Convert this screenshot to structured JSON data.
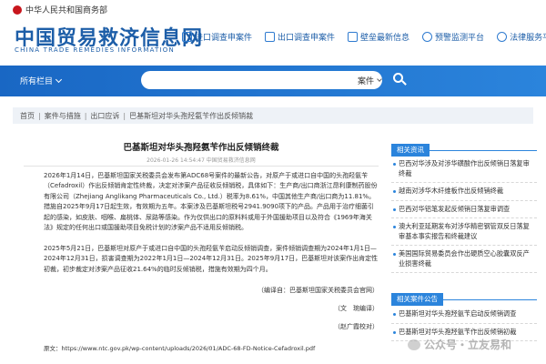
{
  "header": {
    "ministry": "中华人民共和国商务部",
    "site_title": "中国贸易救济信息网",
    "site_title_en": "CHINA TRADE REMEDIES INFORMATION",
    "nav": [
      {
        "label": "进口调查申案件",
        "icon": "document-icon"
      },
      {
        "label": "出口调查申案件",
        "icon": "export-icon"
      },
      {
        "label": "壁垒最新信息",
        "icon": "barrier-icon"
      },
      {
        "label": "预警监测平台",
        "icon": "alert-icon"
      },
      {
        "label": "法律服务平台",
        "icon": "shield-icon"
      }
    ]
  },
  "search": {
    "all_columns": "所有栏目",
    "type_label": "案件",
    "placeholder": ""
  },
  "breadcrumb": [
    "首页",
    "案件与措施",
    "出口应诉",
    "巴基斯坦对华头孢羟氨苄作出反倾销裁"
  ],
  "article": {
    "title": "巴基斯坦对华头孢羟氨苄作出反倾销终裁",
    "date": "2026-01-26 14:54:47  中国贸易救济信息网",
    "para1": "2026年1月14日，巴基斯坦国家关税委员会发布第ADC68号案件的最新公告，对原产于或进口自中国的头孢羟氨苄（Cefadroxil）作出反倾销肯定性终裁，决定对涉案产品征收反倾销税，具体如下：生产商/出口商浙江昂利康制药股份有限公司（Zhejiang Anglikang Pharmaceuticals Co., Ltd.）税率为8.61%，中国其他生产商/出口商为11.81%。措施自2025年9月17日起生效，有效期为五年。本案涉及巴基斯坦税号2941.9090项下的产品。产品用于治疗细菌引起的感染，如皮肤、咽喉、扁桃体、尿路等感染。作为仅供出口的原料料或用于外国援助项目以及符合《1969年海关法》规定的任何出口或国援助项目免税计划的涉案产品不适用反倾销税。",
    "para2": "2025年5月21日，巴基斯坦对原产于或进口自中国的头孢羟氨苄启动反倾销调查，案件倾销调查期为2024年1月1日—2024年12月31日，损害调查期为2022年1月1日—2024年12月31日。2025年9月17日，巴基斯坦对该案作出肯定性初裁，初步裁定对涉案产品征收21.64%的临时反倾销税，措施有效期为四个月。",
    "sig1": "（编译自：巴基斯坦国家关税委员会官网）",
    "sig2": "（文　琬编译）",
    "sig3": "（赵广霞校对）",
    "source": "原文：https://www.ntc.gov.pk/wp-content/uploads/2026/01/ADC-68-FD-Notice-Cefadroxil.pdf"
  },
  "sidebar": {
    "related_news_title": "相关资讯",
    "related_news": [
      "巴西对华涉及对涉华磺酸作出反倾销日落复审终裁",
      "越南对涉华木纤维板作出反倾销终裁",
      "巴西对华铝笔发起反倾销日落复审调查",
      "澳大利亚延期发布对涉华精密钢管双反日落复审基本事实报告和终裁建议",
      "美国国际贸易委员会作出硬质空心胶囊双反产业损害终裁"
    ],
    "related_notice_title": "相关案件公告",
    "related_notices": [
      "巴基斯坦对华头孢羟氨苄启动反倾销调查",
      "巴基斯坦对华头孢羟氨苄作出反倾销初裁"
    ]
  },
  "watermark": "公众号・立友易和"
}
